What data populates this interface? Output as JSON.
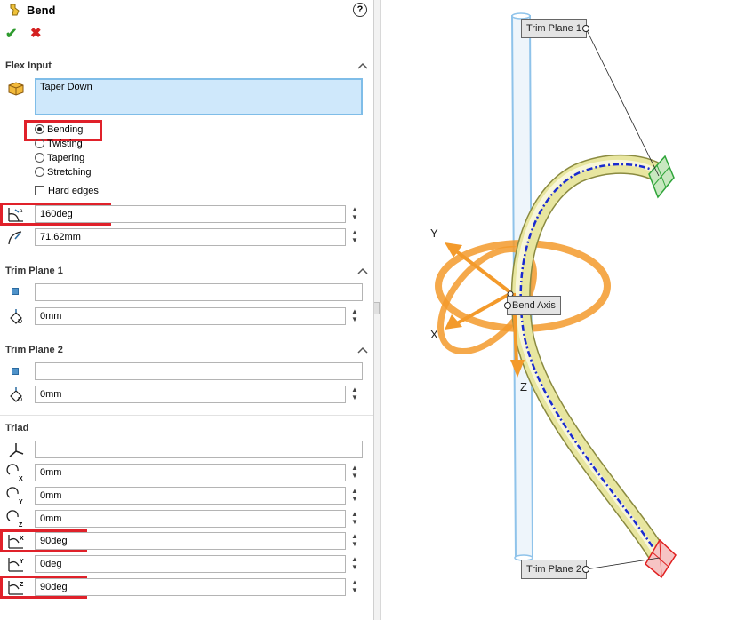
{
  "header": {
    "title": "Bend",
    "help": "?"
  },
  "actions": {
    "ok": "✔",
    "cancel": "✖"
  },
  "flex_input": {
    "title": "Flex Input",
    "selection": "Taper Down",
    "modes": [
      "Bending",
      "Twisting",
      "Tapering",
      "Stretching"
    ],
    "selected_mode": "Bending",
    "hard_edges_label": "Hard edges",
    "hard_edges_checked": false,
    "angle": "160deg",
    "radius": "71.62mm"
  },
  "trim_plane_1": {
    "title": "Trim Plane 1",
    "reference": "",
    "offset": "0mm"
  },
  "trim_plane_2": {
    "title": "Trim Plane 2",
    "reference": "",
    "offset": "0mm"
  },
  "triad": {
    "title": "Triad",
    "reference": "",
    "x_pos": "0mm",
    "y_pos": "0mm",
    "z_pos": "0mm",
    "x_rot": "90deg",
    "y_rot": "0deg",
    "z_rot": "90deg"
  },
  "viewport": {
    "labels": {
      "trim1": "Trim Plane 1",
      "trim2": "Trim Plane 2",
      "bend_axis": "Bend Axis"
    },
    "axes": {
      "x": "X",
      "y": "Y",
      "z": "Z"
    },
    "colors": {
      "tube": "#e8e6a0",
      "triad": "#f39a2b",
      "centerline": "#1a2bd0",
      "trim1": "#2fa53a",
      "trim2": "#e02020",
      "rod": "#8fc3ea"
    }
  }
}
